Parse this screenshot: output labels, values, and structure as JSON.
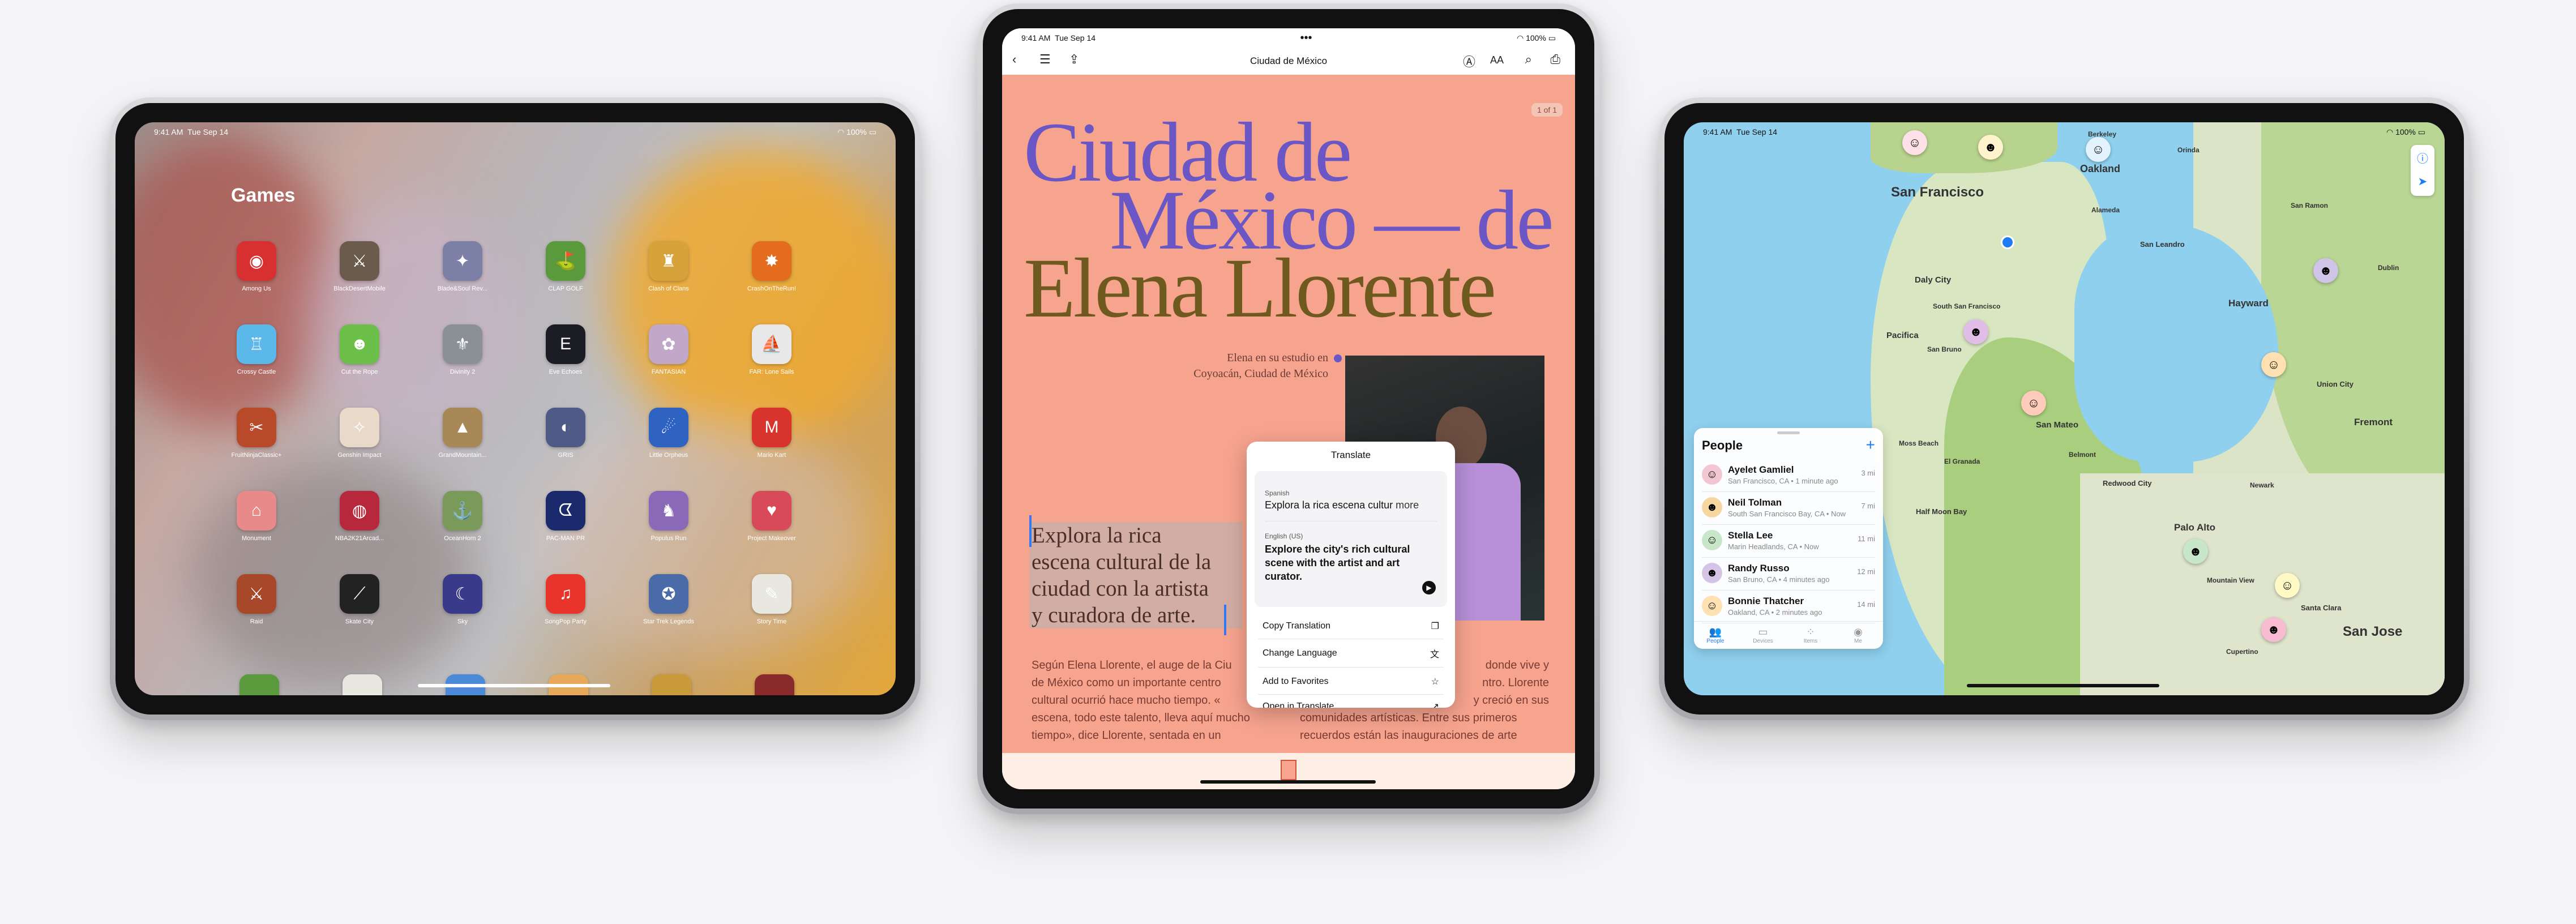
{
  "status": {
    "time": "9:41 AM",
    "date": "Tue Sep 14",
    "battery": "100%"
  },
  "left": {
    "folder_title": "Games",
    "apps": [
      {
        "label": "Among Us",
        "color": "#d83030",
        "glyph": "◉"
      },
      {
        "label": "BlackDesertMobile",
        "color": "#6b5b4c",
        "glyph": "⚔"
      },
      {
        "label": "Blade&Soul Rev...",
        "color": "#7c7fa6",
        "glyph": "✦"
      },
      {
        "label": "CLAP GOLF",
        "color": "#5a9a3c",
        "glyph": "⛳"
      },
      {
        "label": "Clash of Clans",
        "color": "#d8a23a",
        "glyph": "♜"
      },
      {
        "label": "CrashOnTheRun!",
        "color": "#e36c1e",
        "glyph": "✸"
      },
      {
        "label": "Crossy Castle",
        "color": "#5bb8e8",
        "glyph": "♖"
      },
      {
        "label": "Cut the Rope",
        "color": "#6cc04a",
        "glyph": "☻"
      },
      {
        "label": "Divinity 2",
        "color": "#8b8f96",
        "glyph": "⚜"
      },
      {
        "label": "Eve Echoes",
        "color": "#1c1c24",
        "glyph": "E"
      },
      {
        "label": "FANTASIAN",
        "color": "#c2a8c8",
        "glyph": "✿"
      },
      {
        "label": "FAR: Lone Sails",
        "color": "#e8e8e8",
        "glyph": "⛵"
      },
      {
        "label": "FruitNinjaClassic+",
        "color": "#b84a2a",
        "glyph": "✂"
      },
      {
        "label": "Genshin Impact",
        "color": "#e9d9c9",
        "glyph": "✧"
      },
      {
        "label": "GrandMountain...",
        "color": "#a98858",
        "glyph": "▲"
      },
      {
        "label": "GRIS",
        "color": "#4f5b86",
        "glyph": "◐"
      },
      {
        "label": "Little Orpheus",
        "color": "#2f63c2",
        "glyph": "☄"
      },
      {
        "label": "Mario Kart",
        "color": "#d8342c",
        "glyph": "M"
      },
      {
        "label": "Monument",
        "color": "#e88a8a",
        "glyph": "⌂"
      },
      {
        "label": "NBA2K21Arcad...",
        "color": "#b8283c",
        "glyph": "◍"
      },
      {
        "label": "OceanHorn 2",
        "color": "#7a9a5a",
        "glyph": "⚓"
      },
      {
        "label": "PAC-MAN PR",
        "color": "#1a2a6c",
        "glyph": "ᗧ"
      },
      {
        "label": "Populus Run",
        "color": "#8a6ab8",
        "glyph": "♞"
      },
      {
        "label": "Project Makeover",
        "color": "#d84a5a",
        "glyph": "♥"
      },
      {
        "label": "Raid",
        "color": "#a8482a",
        "glyph": "⚔"
      },
      {
        "label": "Skate City",
        "color": "#222222",
        "glyph": "⟋"
      },
      {
        "label": "Sky",
        "color": "#3a3a8a",
        "glyph": "☾"
      },
      {
        "label": "SongPop Party",
        "color": "#e8342a",
        "glyph": "♫"
      },
      {
        "label": "Star Trek Legends",
        "color": "#4a6aa8",
        "glyph": "✪"
      },
      {
        "label": "Story Time",
        "color": "#e8e8e0",
        "glyph": "✎"
      }
    ]
  },
  "center": {
    "toolbar_title": "Ciudad de México",
    "page_badge": "1 of 1",
    "headline_line1": "Ciudad de",
    "headline_line2": "México — de",
    "headline_line3": "Elena Llorente",
    "caption_line1": "Elena en su estudio en",
    "caption_line2": "Coyoacán, Ciudad de México",
    "highlight_line1": "Explora la rica",
    "highlight_line2": "escena cultural de la",
    "highlight_line3": "ciudad con la artista",
    "highlight_line4": "y curadora de arte.",
    "body_left_1": "Según Elena Llorente, el auge de la Ciu",
    "body_left_2": "de México como un importante centro",
    "body_left_3": "cultural ocurrió hace mucho tiempo. «",
    "body_left_4": "escena, todo este talento, lleva aquí mucho",
    "body_left_5": "tiempo», dice Llorente, sentada en un",
    "body_right_1": "donde vive y",
    "body_right_2": "ntro. Llorente",
    "body_right_3": "y creció en sus",
    "body_right_4": "comunidades artísticas. Entre sus primeros",
    "body_right_5": "recuerdos están las inauguraciones de arte",
    "popover": {
      "title": "Translate",
      "source_lang": "Spanish",
      "source_text": "Explora la rica escena cultur",
      "more": "more",
      "target_lang": "English (US)",
      "target_line1": "Explore the city's rich cultural",
      "target_line2": "scene with the artist and art",
      "target_line3": "curator.",
      "actions": [
        "Copy Translation",
        "Change Language",
        "Add to Favorites",
        "Open in Translate"
      ]
    }
  },
  "right": {
    "cities": [
      {
        "name": "San Francisco",
        "big": true
      },
      {
        "name": "Oakland",
        "big": false
      },
      {
        "name": "Daly City",
        "big": false
      },
      {
        "name": "South San Francisco",
        "big": false
      },
      {
        "name": "Pacifica",
        "big": false
      },
      {
        "name": "San Bruno",
        "big": false
      },
      {
        "name": "Hayward",
        "big": false
      },
      {
        "name": "Fremont",
        "big": false
      },
      {
        "name": "San Mateo",
        "big": false
      },
      {
        "name": "Redwood City",
        "big": false
      },
      {
        "name": "Palo Alto",
        "big": false
      },
      {
        "name": "San Jose",
        "big": true
      },
      {
        "name": "Santa Clara",
        "big": false
      },
      {
        "name": "Mountain View",
        "big": false
      },
      {
        "name": "Half Moon Bay",
        "big": false
      },
      {
        "name": "Union City",
        "big": false
      },
      {
        "name": "San Leandro",
        "big": false
      },
      {
        "name": "Berkeley",
        "big": false
      },
      {
        "name": "Dublin",
        "big": false
      },
      {
        "name": "Cupertino",
        "big": false
      },
      {
        "name": "Moss Beach",
        "big": false
      },
      {
        "name": "El Granada",
        "big": false
      },
      {
        "name": "San Ramon",
        "big": false
      },
      {
        "name": "Orinda",
        "big": false
      },
      {
        "name": "Alameda",
        "big": false
      },
      {
        "name": "Belmont",
        "big": false
      },
      {
        "name": "Newark",
        "big": false
      }
    ],
    "people_title": "People",
    "people": [
      {
        "name": "Ayelet Gamliel",
        "loc": "San Francisco, CA • 1 minute ago",
        "dist": "3 mi",
        "color": "#f2c6d2",
        "glyph": "☺"
      },
      {
        "name": "Neil Tolman",
        "loc": "South San Francisco Bay, CA • Now",
        "dist": "7 mi",
        "color": "#f7d7a0",
        "glyph": "☻"
      },
      {
        "name": "Stella Lee",
        "loc": "Marin Headlands, CA • Now",
        "dist": "11 mi",
        "color": "#c8e6c9",
        "glyph": "☺"
      },
      {
        "name": "Randy Russo",
        "loc": "San Bruno, CA • 4 minutes ago",
        "dist": "12 mi",
        "color": "#d6c4e6",
        "glyph": "☻"
      },
      {
        "name": "Bonnie Thatcher",
        "loc": "Oakland, CA • 2 minutes ago",
        "dist": "14 mi",
        "color": "#ffe0b2",
        "glyph": "☺"
      }
    ],
    "tabs": [
      "People",
      "Devices",
      "Items",
      "Me"
    ]
  }
}
